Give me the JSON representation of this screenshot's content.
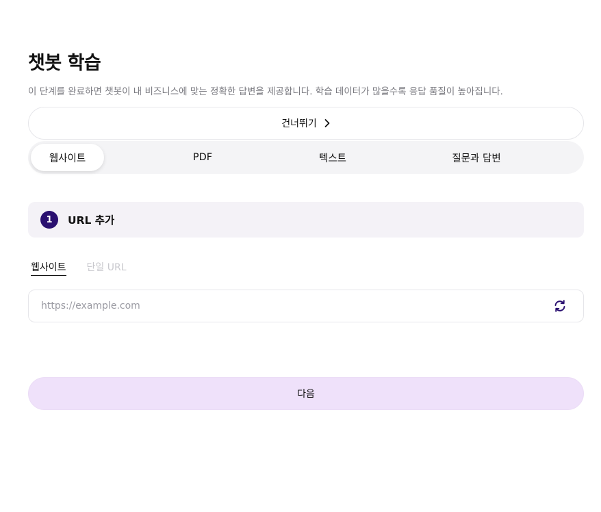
{
  "header": {
    "title": "챗봇 학습",
    "subtitle": "이 단계를 완료하면 챗봇이 내 비즈니스에 맞는 정확한 답변을 제공합니다. 학습 데이터가 많을수록 응답 품질이 높아집니다."
  },
  "skip": {
    "label": "건너뛰기",
    "icon": "chevron-right-icon"
  },
  "tabs": [
    {
      "label": "웹사이트",
      "active": true
    },
    {
      "label": "PDF",
      "active": false
    },
    {
      "label": "텍스트",
      "active": false
    },
    {
      "label": "질문과 답변",
      "active": false
    }
  ],
  "step": {
    "number": "1",
    "title": "URL 추가"
  },
  "subtabs": [
    {
      "label": "웹사이트",
      "active": true
    },
    {
      "label": "단일 URL",
      "active": false
    }
  ],
  "url_input": {
    "placeholder": "https://example.com",
    "value": "",
    "icon": "refresh-icon"
  },
  "next": {
    "label": "다음"
  },
  "colors": {
    "accent_dark": "#2a1070",
    "next_button_bg": "#efe1fa",
    "tab_bar_bg": "#f4f4f6",
    "step_card_bg": "#f4f2f7"
  }
}
